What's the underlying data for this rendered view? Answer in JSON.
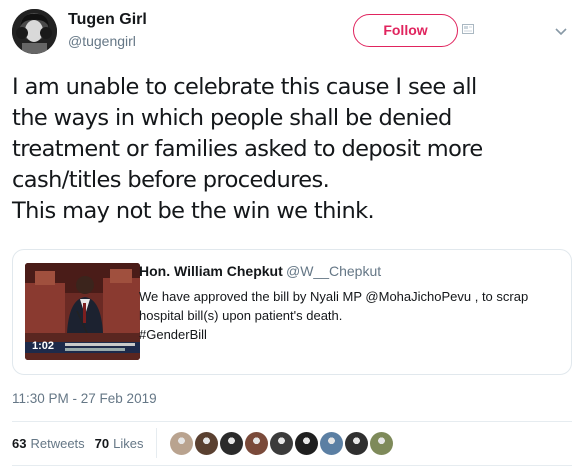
{
  "author": {
    "name": "Tugen Girl",
    "handle": "@tugengirl",
    "avatar_icon": "profile-photo"
  },
  "follow_button": {
    "label": "Follow",
    "color": "#e0245e"
  },
  "tweet": {
    "text": "I am unable to celebrate this cause I see all\nthe ways in which people shall be denied\ntreatment or families asked to deposit more\ncash/titles before procedures.\nThis may not be the win we think."
  },
  "quoted": {
    "name": "Hon. William Chepkut",
    "handle": "@W__Chepkut",
    "lines": [
      "We have approved the bill by Nyali MP @MohaJichoPevu , to scrap",
      "hospital bill(s) upon patient's death.",
      "#GenderBill"
    ],
    "video_time": "1:02"
  },
  "timestamp": "11:30 PM - 27 Feb 2019",
  "stats": {
    "retweets_count": "63",
    "retweets_label": "Retweets",
    "likes_count": "70",
    "likes_label": "Likes"
  },
  "likers": [
    "#b9a38f",
    "#5a4030",
    "#2b2b2b",
    "#7a4a3a",
    "#3b3b3b",
    "#1f1f1f",
    "#5b7fa3",
    "#2f2f2f",
    "#7e8a5a"
  ]
}
